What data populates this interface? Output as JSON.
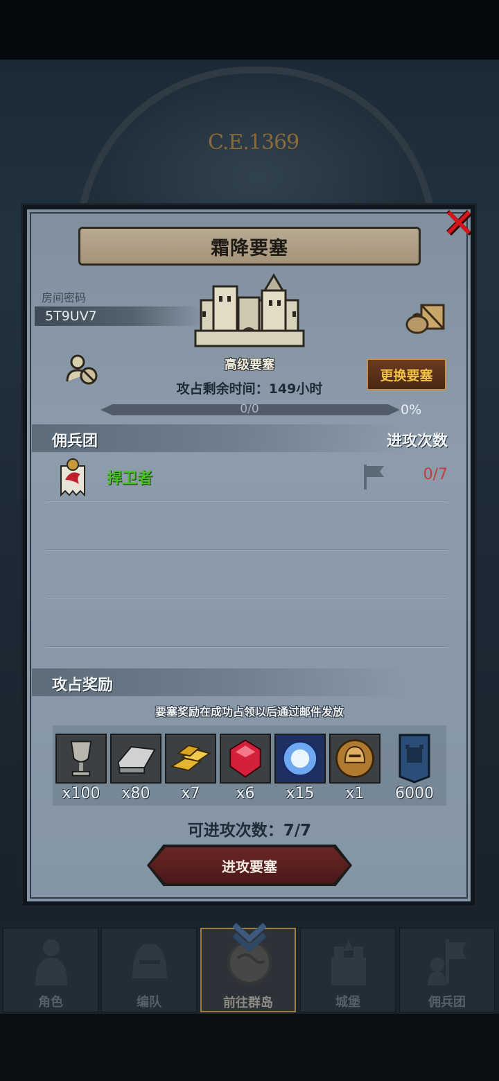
{
  "background": {
    "year": "C.E.1369"
  },
  "dialog": {
    "title": "霜降要塞",
    "room_label": "房间密码",
    "room_code": "5T9UV7",
    "fortress_name": "高级要塞",
    "change_button": "更换要塞",
    "time_text": "攻占剩余时间：149小时",
    "progress": {
      "text": "0/0",
      "percent": "0%",
      "fraction": 0
    }
  },
  "mercenary_section": {
    "title": "佣兵团",
    "column_header": "进攻次数",
    "rows": [
      {
        "name": "捍卫者",
        "attacks": "0/7"
      }
    ]
  },
  "reward_section": {
    "title": "攻占奖励",
    "note": "要塞奖励在成功占领以后通过邮件发放",
    "items": [
      {
        "icon": "goblet-icon",
        "qty": "x100"
      },
      {
        "icon": "iron-ingot-icon",
        "qty": "x80"
      },
      {
        "icon": "gold-bars-icon",
        "qty": "x7"
      },
      {
        "icon": "ruby-icon",
        "qty": "x6"
      },
      {
        "icon": "crystal-orb-icon",
        "qty": "x15"
      },
      {
        "icon": "helmet-medal-icon",
        "qty": "x1"
      },
      {
        "icon": "castle-banner-icon",
        "qty": "6000"
      }
    ]
  },
  "attack": {
    "remaining": "可进攻次数：7/7",
    "button": "进攻要塞"
  },
  "nav": {
    "items": [
      {
        "label": "角色",
        "icon": "knight-icon"
      },
      {
        "label": "编队",
        "icon": "helmet-icon"
      },
      {
        "label": "前往群岛",
        "icon": "globe-icon"
      },
      {
        "label": "城堡",
        "icon": "castle-icon"
      },
      {
        "label": "佣兵团",
        "icon": "mercenary-icon"
      }
    ]
  },
  "colors": {
    "close": "#d4151a",
    "merc_name": "#4cbd2a",
    "merc_count": "#c23e3e",
    "change_button_text": "#f2c247",
    "attack_button": "#5a1f1f"
  }
}
